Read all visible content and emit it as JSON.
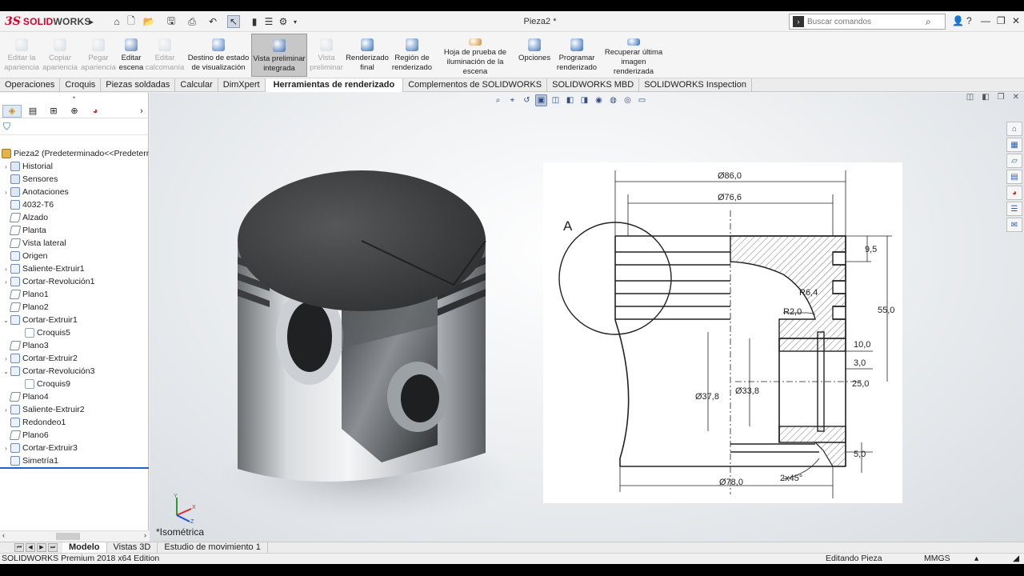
{
  "app": {
    "logo_ds": "3S",
    "logo_solid": "SOLID",
    "logo_works": "WORKS",
    "document_title": "Pieza2 *",
    "search_placeholder": "Buscar comandos",
    "accent": "#d6002a"
  },
  "commands": [
    {
      "label": "Editar la apariencia",
      "enabled": false,
      "icon": "edit-appearance-icon"
    },
    {
      "label": "Copiar apariencia",
      "enabled": false,
      "icon": "copy-appearance-icon"
    },
    {
      "label": "Pegar apariencia",
      "enabled": false,
      "icon": "paste-appearance-icon"
    },
    {
      "label": "Editar escena",
      "enabled": true,
      "icon": "edit-scene-icon"
    },
    {
      "label": "Editar calcomanía",
      "enabled": false,
      "icon": "edit-decal-icon"
    },
    {
      "label": "Destino de estado de visualización",
      "enabled": true,
      "icon": "display-state-icon"
    },
    {
      "label": "Vista preliminar integrada",
      "enabled": true,
      "active": true,
      "icon": "integrated-preview-icon"
    },
    {
      "label": "Vista preliminar",
      "enabled": false,
      "icon": "preview-window-icon"
    },
    {
      "label": "Renderizado final",
      "enabled": true,
      "icon": "final-render-icon"
    },
    {
      "label": "Región de renderizado",
      "enabled": true,
      "icon": "render-region-icon"
    },
    {
      "label": "Hoja de prueba de iluminación de la escena",
      "enabled": true,
      "icon": "lighting-proof-icon"
    },
    {
      "label": "Opciones",
      "enabled": true,
      "icon": "options-icon"
    },
    {
      "label": "Programar renderizado",
      "enabled": true,
      "icon": "schedule-render-icon"
    },
    {
      "label": "Recuperar última imagen renderizada",
      "enabled": true,
      "icon": "recall-image-icon"
    }
  ],
  "tabs": [
    "Operaciones",
    "Croquis",
    "Piezas soldadas",
    "Calcular",
    "DimXpert",
    "Herramientas de renderizado",
    "Complementos de SOLIDWORKS",
    "SOLIDWORKS MBD",
    "SOLIDWORKS Inspection"
  ],
  "active_tab": "Herramientas de renderizado",
  "tree": [
    {
      "label": "Pieza2  (Predeterminado<<Predeterm",
      "expand": "",
      "icon": "part-icon",
      "indent": 0
    },
    {
      "label": "Historial",
      "expand": "›",
      "icon": "history-icon",
      "indent": 1
    },
    {
      "label": "Sensores",
      "expand": "",
      "icon": "sensors-icon",
      "indent": 1
    },
    {
      "label": "Anotaciones",
      "expand": "›",
      "icon": "annotations-icon",
      "indent": 1
    },
    {
      "label": "4032-T6",
      "expand": "",
      "icon": "material-icon",
      "indent": 1
    },
    {
      "label": "Alzado",
      "expand": "",
      "icon": "plane-icon",
      "indent": 1
    },
    {
      "label": "Planta",
      "expand": "",
      "icon": "plane-icon",
      "indent": 1
    },
    {
      "label": "Vista lateral",
      "expand": "",
      "icon": "plane-icon",
      "indent": 1
    },
    {
      "label": "Origen",
      "expand": "",
      "icon": "origin-icon",
      "indent": 1
    },
    {
      "label": "Saliente-Extruir1",
      "expand": "›",
      "icon": "boss-extrude-icon",
      "indent": 1
    },
    {
      "label": "Cortar-Revolución1",
      "expand": "›",
      "icon": "cut-revolve-icon",
      "indent": 1
    },
    {
      "label": "Plano1",
      "expand": "",
      "icon": "plane-icon",
      "indent": 1
    },
    {
      "label": "Plano2",
      "expand": "",
      "icon": "plane-icon",
      "indent": 1
    },
    {
      "label": "Cortar-Extruir1",
      "expand": "⌄",
      "icon": "cut-extrude-icon",
      "indent": 1
    },
    {
      "label": "Croquis5",
      "expand": "",
      "icon": "sketch-icon",
      "indent": 2
    },
    {
      "label": "Plano3",
      "expand": "",
      "icon": "plane-icon",
      "indent": 1
    },
    {
      "label": "Cortar-Extruir2",
      "expand": "›",
      "icon": "cut-extrude-icon",
      "indent": 1
    },
    {
      "label": "Cortar-Revolución3",
      "expand": "⌄",
      "icon": "cut-revolve-icon",
      "indent": 1
    },
    {
      "label": "Croquis9",
      "expand": "",
      "icon": "sketch-icon",
      "indent": 2
    },
    {
      "label": "Plano4",
      "expand": "",
      "icon": "plane-icon",
      "indent": 1
    },
    {
      "label": "Saliente-Extruir2",
      "expand": "›",
      "icon": "boss-extrude-icon",
      "indent": 1
    },
    {
      "label": "Redondeo1",
      "expand": "",
      "icon": "fillet-icon",
      "indent": 1
    },
    {
      "label": "Plano6",
      "expand": "",
      "icon": "plane-icon",
      "indent": 1
    },
    {
      "label": "Cortar-Extruir3",
      "expand": "›",
      "icon": "cut-extrude-icon",
      "indent": 1
    },
    {
      "label": "Simetría1",
      "expand": "",
      "icon": "mirror-icon",
      "indent": 1
    }
  ],
  "viewport": {
    "view_name": "*Isométrica",
    "triad": {
      "x": "X",
      "y": "Y",
      "z": "Z"
    }
  },
  "drawing": {
    "dims": {
      "d86": "Ø86,0",
      "d76": "Ø76,6",
      "d378": "Ø37,8",
      "d338": "Ø33,8",
      "d78": "Ø78,0",
      "v95": "9,5",
      "v55": "55,0",
      "v10": "10,0",
      "v3": "3,0",
      "v25": "25,0",
      "v5": "5,0",
      "r64": "R6,4",
      "r2": "R2,0",
      "chamfer": "2x45°",
      "detail": "A"
    }
  },
  "bottom_tabs": [
    "Modelo",
    "Vistas 3D",
    "Estudio de movimiento 1"
  ],
  "active_bottom_tab": "Modelo",
  "status": {
    "edition": "SOLIDWORKS Premium 2018 x64 Edition",
    "mode": "Editando Pieza",
    "units": "MMGS"
  }
}
